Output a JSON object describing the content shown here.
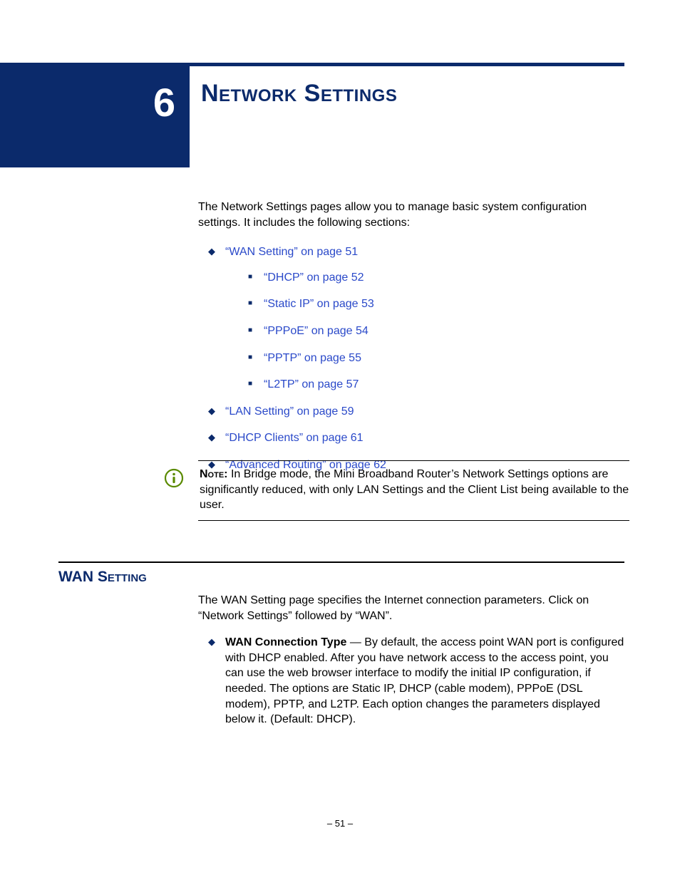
{
  "chapter": {
    "number": "6",
    "title": "Network Settings"
  },
  "intro": "The Network Settings pages allow you to manage basic system configuration settings. It includes the following sections:",
  "toc": [
    {
      "label": "“WAN Setting” on page 51",
      "children": [
        {
          "label": "“DHCP” on page 52"
        },
        {
          "label": "“Static IP” on page 53"
        },
        {
          "label": "“PPPoE” on page 54"
        },
        {
          "label": "“PPTP” on page 55"
        },
        {
          "label": "“L2TP” on page 57"
        }
      ]
    },
    {
      "label": "“LAN Setting” on page 59"
    },
    {
      "label": "“DHCP Clients” on page 61"
    },
    {
      "label": "“Advanced Routing” on page 62"
    }
  ],
  "note": {
    "label": "Note:",
    "text": " In Bridge mode, the Mini Broadband Router’s Network Settings options are significantly reduced, with only LAN Settings and the Client List being available to the user."
  },
  "section": {
    "heading": "WAN Setting",
    "intro": "The WAN Setting page specifies the Internet connection parameters. Click on “Network Settings” followed by “WAN”.",
    "param_name": "WAN Connection Type",
    "param_sep": " — ",
    "param_text": "By default, the access point WAN port is configured with DHCP enabled. After you have network access to the access point, you can use the web browser interface to modify the initial IP configuration, if needed. The options are Static IP, DHCP (cable modem), PPPoE (DSL modem), PPTP, and L2TP. Each option changes the parameters displayed below it. (Default: DHCP)."
  },
  "footer": {
    "page": "–  51  –"
  }
}
